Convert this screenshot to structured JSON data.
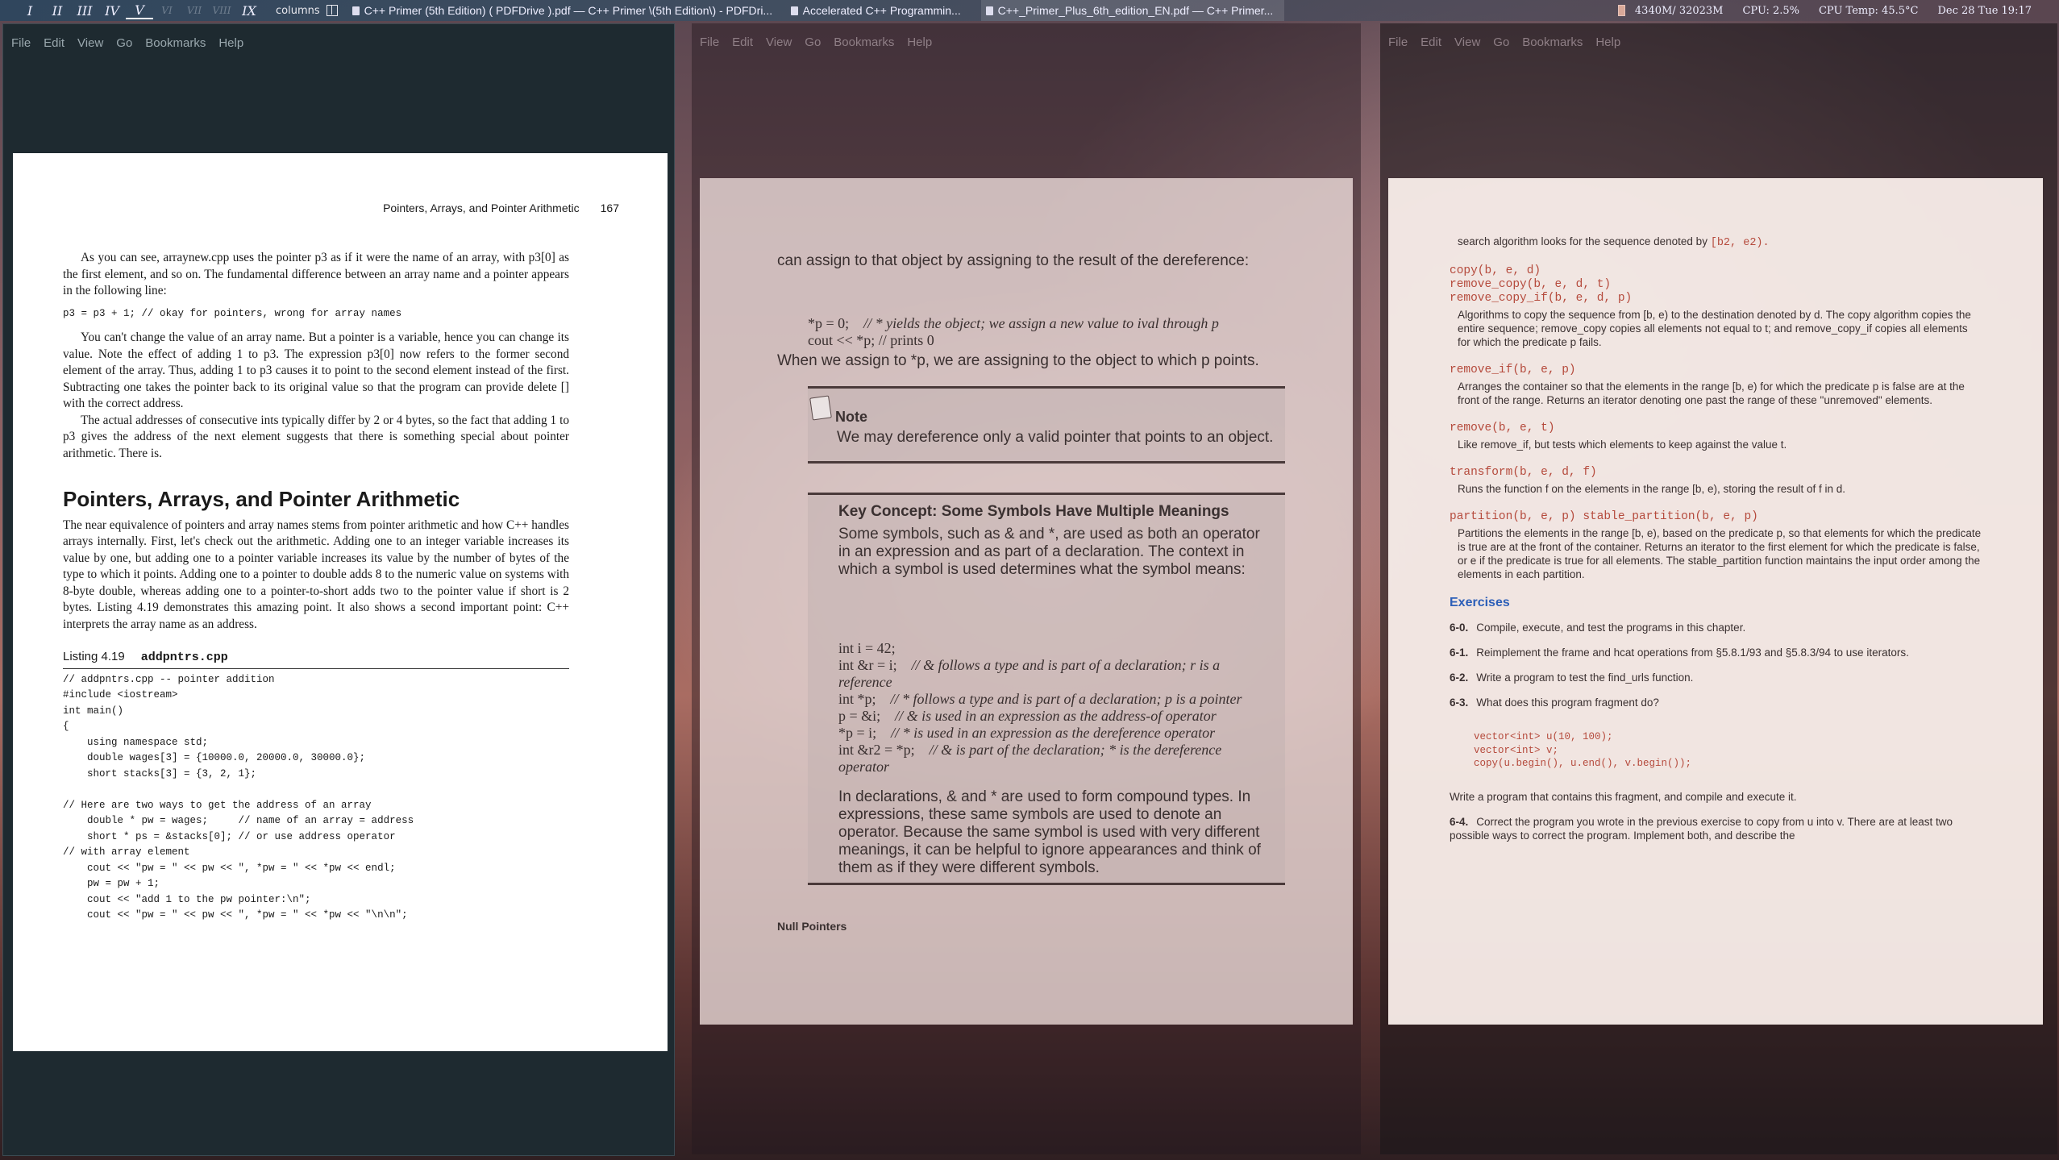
{
  "topbar": {
    "workspaces": [
      "I",
      "II",
      "III",
      "IV",
      "V",
      "VI",
      "VII",
      "VIII",
      "IX"
    ],
    "layout_label": "columns",
    "tasks": [
      "C++ Primer (5th Edition) ( PDFDrive ).pdf — C++ Primer \\(5th Edition\\) - PDFDri...",
      "Accelerated C++ Programmin...",
      "C++_Primer_Plus_6th_edition_EN.pdf — C++ Primer..."
    ],
    "memory": "4340M/ 32023M",
    "cpu": "CPU: 2.5%",
    "cpu_temp": "CPU Temp: 45.5°C",
    "datetime": "Dec 28 Tue 19:17"
  },
  "menu": [
    "File",
    "Edit",
    "View",
    "Go",
    "Bookmarks",
    "Help"
  ],
  "page1": {
    "running_head": "Pointers, Arrays, and Pointer Arithmetic",
    "page_number": "167",
    "para1": "As you can see, arraynew.cpp uses the pointer p3 as if it were the name of an array, with p3[0] as the first element, and so on. The fundamental difference between an array name and a pointer appears in the following line:",
    "code1": "p3 = p3 + 1; // okay for pointers, wrong for array names",
    "para2": "You can't change the value of an array name. But a pointer is a variable, hence you can change its value. Note the effect of adding 1 to p3. The expression p3[0] now refers to the former second element of the array. Thus, adding 1 to p3 causes it to point to the second element instead of the first. Subtracting one takes the pointer back to its original value so that the program can provide delete [] with the correct address.",
    "para3": "The actual addresses of consecutive ints typically differ by 2 or 4 bytes, so the fact that adding 1 to p3 gives the address of the next element suggests that there is something special about pointer arithmetic. There is.",
    "heading": "Pointers, Arrays, and Pointer Arithmetic",
    "para4": "The near equivalence of pointers and array names stems from pointer arithmetic and how C++ handles arrays internally. First, let's check out the arithmetic. Adding one to an integer variable increases its value by one, but adding one to a pointer variable increases its value by the number of bytes of the type to which it points. Adding one to a pointer to double adds 8 to the numeric value on systems with 8-byte double, whereas adding one to a pointer-to-short adds two to the pointer value if short is 2 bytes. Listing 4.19 demonstrates this amazing point. It also shows a second important point: C++ interprets the array name as an address.",
    "listing_label": "Listing 4.19",
    "listing_file": "addpntrs.cpp",
    "listing_code": "// addpntrs.cpp -- pointer addition\n#include <iostream>\nint main()\n{\n    using namespace std;\n    double wages[3] = {10000.0, 20000.0, 30000.0};\n    short stacks[3] = {3, 2, 1};\n\n// Here are two ways to get the address of an array\n    double * pw = wages;     // name of an array = address\n    short * ps = &stacks[0]; // or use address operator\n// with array element\n    cout << \"pw = \" << pw << \", *pw = \" << *pw << endl;\n    pw = pw + 1;\n    cout << \"add 1 to the pw pointer:\\n\";\n    cout << \"pw = \" << pw << \", *pw = \" << *pw << \"\\n\\n\";"
  },
  "page2": {
    "line1": "can assign to that object by assigning to the result of the dereference:",
    "code_a": "*p = 0;",
    "code_a_comment": "// * yields the object; we assign a new value to ival through p",
    "code_b": "cout << *p; // prints 0",
    "line2": "When we assign to *p, we are assigning to the object to which p points.",
    "note_title": "Note",
    "note_text": "We may dereference only a valid pointer that points to an object.",
    "key_title": "Key Concept: Some Symbols Have Multiple Meanings",
    "key_intro": "Some symbols, such as & and *, are used as both an operator in an expression and as part of a declaration. The context in which a symbol is used determines what the symbol means:",
    "key_code": [
      {
        "code": "int i = 42;",
        "comment": ""
      },
      {
        "code": "int &r = i;",
        "comment": "// & follows a type and is part of a declaration; r is a reference"
      },
      {
        "code": "int *p;",
        "comment": "// * follows a type and is part of a declaration; p is a pointer"
      },
      {
        "code": "p = &i;",
        "comment": "// & is used in an expression as the address-of operator"
      },
      {
        "code": "*p = i;",
        "comment": "// * is used in an expression as the dereference operator"
      },
      {
        "code": "int &r2 = *p;",
        "comment": "// & is part of the declaration; * is the dereference operator"
      }
    ],
    "key_outro": "In declarations, & and * are used to form compound types. In expressions, these same symbols are used to denote an operator. Because the same symbol is used with very different meanings, it can be helpful to ignore appearances and think of them as if they were different symbols.",
    "next_heading": "Null Pointers"
  },
  "page3": {
    "intro": "search algorithm looks for the sequence denoted by",
    "intro_code": "[b2, e2).",
    "entries": [
      {
        "sig": [
          "copy(b, e, d)",
          "remove_copy(b, e, d, t)",
          "remove_copy_if(b, e, d, p)"
        ],
        "desc": "Algorithms to copy the sequence from [b, e) to the destination denoted by d. The copy algorithm copies the entire sequence; remove_copy copies all elements not equal to t; and remove_copy_if copies all elements for which the predicate p fails."
      },
      {
        "sig": [
          "remove_if(b, e, p)"
        ],
        "desc": "Arranges the container so that the elements in the range [b, e) for which the predicate p is false are at the front of the range. Returns an iterator denoting one past the range of these \"unremoved\" elements."
      },
      {
        "sig": [
          "remove(b, e, t)"
        ],
        "desc": "Like remove_if, but tests which elements to keep against the value t."
      },
      {
        "sig": [
          "transform(b, e, d, f)"
        ],
        "desc": "Runs the function f on the elements in the range [b, e), storing the result of f in d."
      },
      {
        "sig": [
          "partition(b, e, p) stable_partition(b, e, p)"
        ],
        "desc": "Partitions the elements in the range [b, e), based on the predicate p, so that elements for which the predicate is true are at the front of the container. Returns an iterator to the first element for which the predicate is false, or e if the predicate is true for all elements. The stable_partition function maintains the input order among the elements in each partition."
      }
    ],
    "exercises_title": "Exercises",
    "exercises": [
      {
        "num": "6-0.",
        "text": "Compile, execute, and test the programs in this chapter."
      },
      {
        "num": "6-1.",
        "text": "Reimplement the frame and hcat operations from §5.8.1/93 and §5.8.3/94 to use iterators."
      },
      {
        "num": "6-2.",
        "text": "Write a program to test the find_urls function."
      },
      {
        "num": "6-3.",
        "text": "What does this program fragment do?"
      }
    ],
    "fragment": "vector<int> u(10, 100);\nvector<int> v;\ncopy(u.begin(), u.end(), v.begin());",
    "after_fragment": "Write a program that contains this fragment, and compile and execute it.",
    "ex4_num": "6-4.",
    "ex4_text": "Correct the program you wrote in the previous exercise to copy from u into v. There are at least two possible ways to correct the program. Implement both, and describe the"
  }
}
